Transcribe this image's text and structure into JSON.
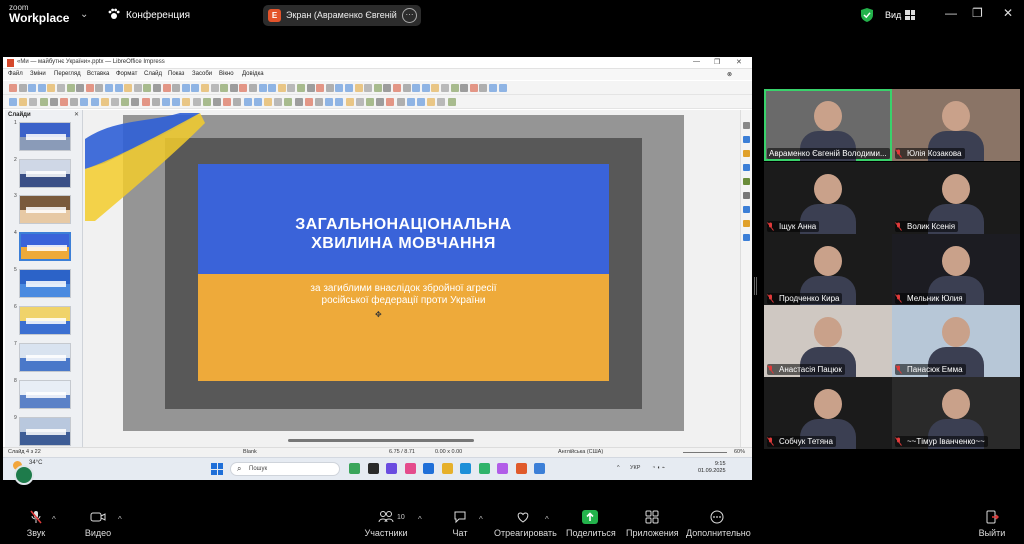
{
  "topbar": {
    "logo_line1": "zoom",
    "logo_line2": "Workplace",
    "meeting_label": "Конференция",
    "share_badge": "E",
    "share_text": "Экран (Авраменко Євгеній Вол",
    "view_label": "Вид",
    "icons": [
      "chevron-down-icon",
      "paw-icon",
      "more-icon",
      "shield-check-icon",
      "grid-icon",
      "minimize-icon",
      "restore-icon",
      "close-icon"
    ],
    "colors": {
      "shield": "#23b24b",
      "badge": "#e4542b"
    }
  },
  "libreoffice": {
    "window_title": "«Ми — майбутнє України».pptx — LibreOffice Impress",
    "menu": [
      "Файл",
      "Зміни",
      "Перегляд",
      "Вставка",
      "Формат",
      "Слайд",
      "Показ",
      "Засоби",
      "Вікно",
      "Довідка"
    ],
    "sidebar_title": "Слайди",
    "slides": [
      {
        "num": "1",
        "top": "#3b62c9",
        "bottom": "#8a9bb8"
      },
      {
        "num": "2",
        "top": "#cfd7e6",
        "bottom": "#3a4f86"
      },
      {
        "num": "3",
        "top": "#7a5a3c",
        "bottom": "#e7c9a4"
      },
      {
        "num": "4",
        "top": "#3a63d9",
        "bottom": "#eeaa3a"
      },
      {
        "num": "5",
        "top": "#2c63c8",
        "bottom": "#4a8ae0"
      },
      {
        "num": "6",
        "top": "#f0d36a",
        "bottom": "#3b6fd1"
      },
      {
        "num": "7",
        "top": "#d9e3f0",
        "bottom": "#4a78c9"
      },
      {
        "num": "8",
        "top": "#e8eef6",
        "bottom": "#5c82c7"
      },
      {
        "num": "9",
        "top": "#b9c8de",
        "bottom": "#3e5d96"
      }
    ],
    "current_slide": {
      "title_line1": "ЗАГАЛЬНОНАЦІОНАЛЬНА",
      "title_line2": "ХВИЛИНА МОВЧАННЯ",
      "subtitle_line1": "за загиблими внаслідок збройної агресії",
      "subtitle_line2": "російської федерації проти України",
      "colors": {
        "blue": "#3a63d9",
        "yellow": "#eeaa3a"
      }
    },
    "status": {
      "slide_count": "Слайд 4 з 22",
      "layout": "Blank",
      "position": "6.75 / 8.71",
      "size": "0.00 x 0.00",
      "language": "Англійська (США)",
      "zoom": "60%"
    }
  },
  "taskbar": {
    "temperature": "34°C",
    "search_placeholder": "Пошук",
    "language": "УКР",
    "time": "9:15",
    "date": "01.09.2025"
  },
  "participants": [
    {
      "name": "Авраменко Євгеній Володими...",
      "muted": false,
      "active": true,
      "bg": "#6a6a6a"
    },
    {
      "name": "Юлія Козакова",
      "muted": true,
      "active": false,
      "bg": "#8a7466"
    },
    {
      "name": "Іщук Анна",
      "muted": true,
      "active": false,
      "bg": "#1b1b1b"
    },
    {
      "name": "Волик Ксенія",
      "muted": true,
      "active": false,
      "bg": "#1b1b1b"
    },
    {
      "name": "Продченко Кира",
      "muted": true,
      "active": false,
      "bg": "#1b1b1b"
    },
    {
      "name": "Мельник Юлия",
      "muted": true,
      "active": false,
      "bg": "#1c1c22"
    },
    {
      "name": "Анастасія Пацюк",
      "muted": true,
      "active": false,
      "bg": "#cfc8c2"
    },
    {
      "name": "Панасюк Емма",
      "muted": true,
      "active": false,
      "bg": "#b7c7d7"
    },
    {
      "name": "Собчук Тетяна",
      "muted": true,
      "active": false,
      "bg": "#1b1b1b"
    },
    {
      "name": "~~Тімур Іванченко~~",
      "muted": true,
      "active": false,
      "bg": "#2a2a2a"
    }
  ],
  "bottombar": {
    "audio": "Звук",
    "video": "Видео",
    "participants": "Участники",
    "participants_count": "10",
    "chat": "Чат",
    "react": "Отреагировать",
    "share": "Поделиться",
    "apps": "Приложения",
    "more": "Дополнительно",
    "leave": "Выйти",
    "colors": {
      "share": "#23b24b",
      "leave": "#e03a3a",
      "muted": "#e03a3a"
    }
  }
}
